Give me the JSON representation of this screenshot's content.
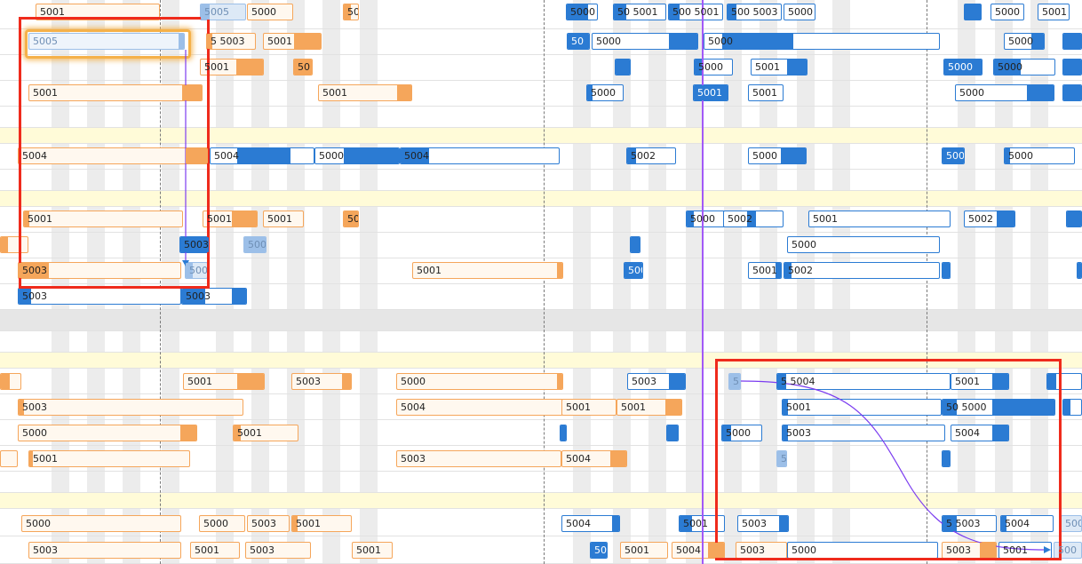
{
  "gantt": {
    "colors": {
      "planned": "#f5a65b",
      "active": "#2b7bd3",
      "ghost": "#9cbfe8",
      "highlight_row": "#fffbd8",
      "selection": "#ef2b1c",
      "current_time": "#a259f7",
      "dependency": "#7b3cf0"
    },
    "labels": {
      "l5000": "5000",
      "l5001": "5001",
      "l5002": "5002",
      "l5003": "5003",
      "l5004": "5004",
      "l5005": "5005",
      "l50": "50",
      "l5": "5",
      "l500": "500",
      "l50m5001": "50 5001",
      "l500m5001": "500 5001",
      "l5001m5003": "500 5003",
      "l5003s": "5 5003",
      "l5004s": "5 5004",
      "l5000s": "50 5000",
      "l5001s": "5001",
      "lss": "5 5"
    }
  }
}
